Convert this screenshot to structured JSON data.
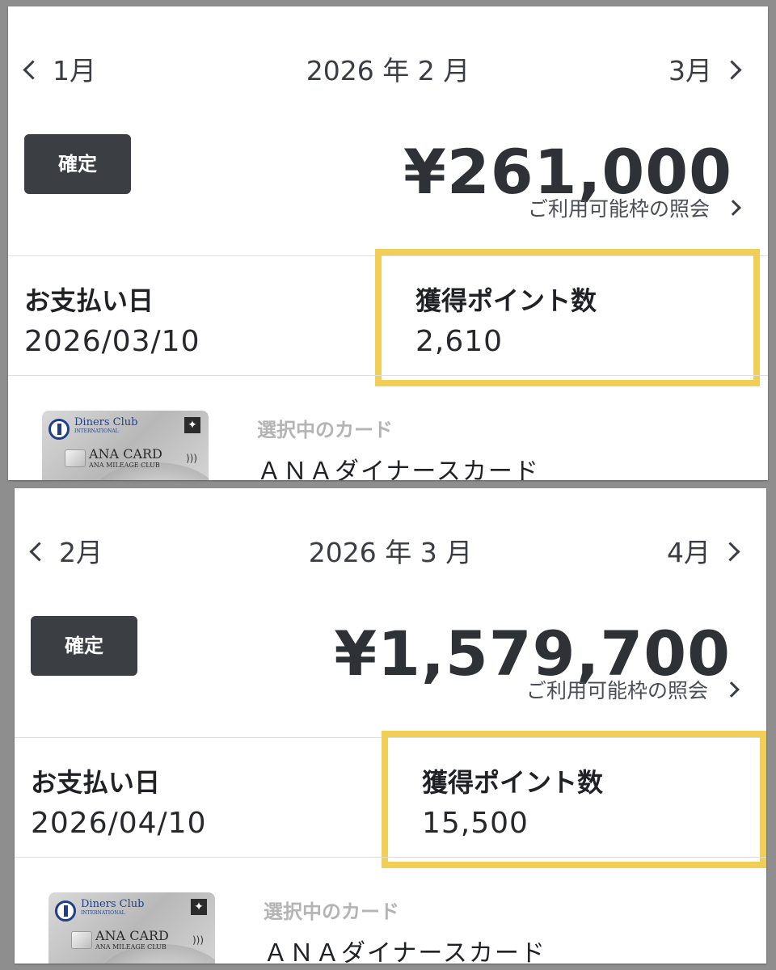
{
  "screens": [
    {
      "prev_month": "1月",
      "current_month": "2026 年 2 月",
      "next_month": "3月",
      "status": "確定",
      "amount": "¥261,000",
      "limit_link": "ご利用可能枠の照会",
      "payment_label": "お支払い日",
      "payment_date": "2026/03/10",
      "points_label": "獲得ポイント数",
      "points_value": "2,610",
      "selected_card_label": "選択中のカード",
      "card_name": "ＡＮＡダイナースカード",
      "card_image": {
        "brand": "Diners Club",
        "brand_sub": "INTERNATIONAL",
        "card_title": "ANA CARD",
        "card_sub": "ANA MILEAGE CLUB"
      }
    },
    {
      "prev_month": "2月",
      "current_month": "2026 年 3 月",
      "next_month": "4月",
      "status": "確定",
      "amount": "¥1,579,700",
      "limit_link": "ご利用可能枠の照会",
      "payment_label": "お支払い日",
      "payment_date": "2026/04/10",
      "points_label": "獲得ポイント数",
      "points_value": "15,500",
      "selected_card_label": "選択中のカード",
      "card_name": "ＡＮＡダイナースカード",
      "card_image": {
        "brand": "Diners Club",
        "brand_sub": "INTERNATIONAL",
        "card_title": "ANA CARD",
        "card_sub": "ANA MILEAGE CLUB"
      }
    }
  ],
  "colors": {
    "highlight": "#f1cf57",
    "status_bg": "#3b3e43",
    "text": "#2f3238"
  }
}
